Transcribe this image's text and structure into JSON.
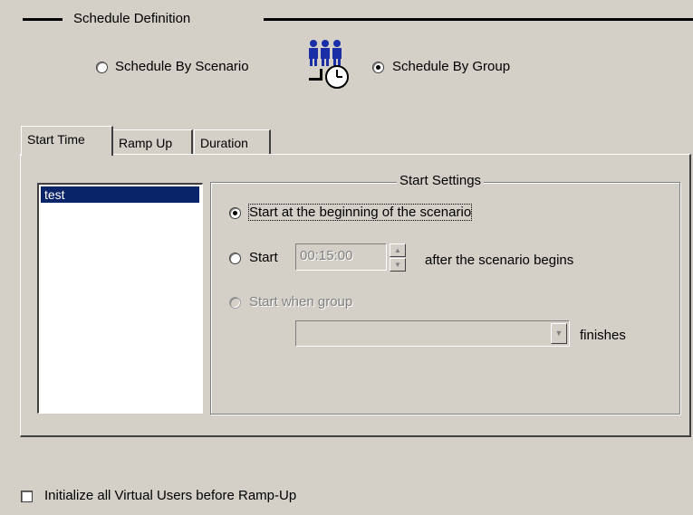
{
  "schedule_definition": {
    "title": "Schedule Definition",
    "options": [
      {
        "label": "Schedule By Scenario",
        "selected": false
      },
      {
        "label": "Schedule By Group",
        "selected": true
      }
    ],
    "icon": "group-schedule-icon"
  },
  "tabs": [
    {
      "label": "Start Time",
      "active": true
    },
    {
      "label": "Ramp Up",
      "active": false
    },
    {
      "label": "Duration",
      "active": false
    }
  ],
  "groups_list": {
    "items": [
      "test"
    ],
    "selected_index": 0
  },
  "start_settings": {
    "title": "Start Settings",
    "option_beginning": "Start at the beginning of the scenario",
    "option_start_after": "Start",
    "start_after_value": "00:15:00",
    "after_label": "after the scenario begins",
    "option_when_group": "Start when  group",
    "when_group_value": "",
    "finishes_label": "finishes",
    "selected_option": "beginning"
  },
  "initialize_checkbox": {
    "label": "Initialize all Virtual Users before Ramp-Up",
    "checked": false
  },
  "colors": {
    "background": "#d4d0c8",
    "selection": "#0a246a",
    "icon_blue": "#1a2ea8"
  }
}
